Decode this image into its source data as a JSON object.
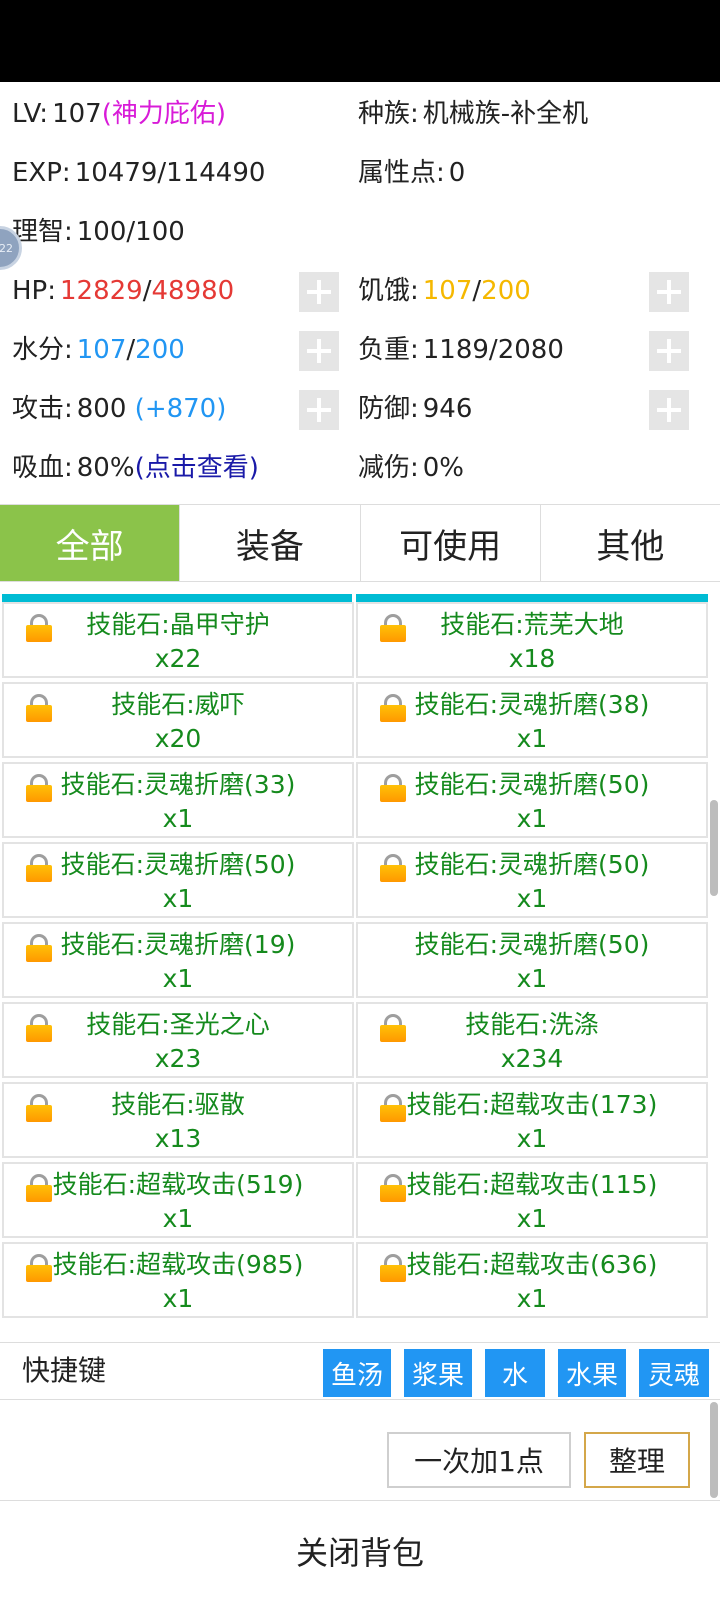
{
  "colors": {
    "red": "#e53935",
    "yellow": "#f5b800",
    "blue": "#2196f3",
    "magenta": "#d81bd8",
    "navy": "#1a1aa8",
    "green": "#158a1d",
    "tab_active": "#8bc34a"
  },
  "stats": {
    "lv_label": "LV:",
    "lv_value": "107",
    "lv_title": "(神力庇佑)",
    "race_label": "种族:",
    "race_value": "机械族-补全机",
    "exp_label": "EXP:",
    "exp_value": "10479/114490",
    "attr_label": "属性点:",
    "attr_value": "0",
    "sanity_label": "理智:",
    "sanity_value": "100/100",
    "hp_label": "HP:",
    "hp_cur": "12829",
    "hp_sep": "/",
    "hp_max": "48980",
    "hunger_label": "饥饿:",
    "hunger_cur": "107",
    "hunger_sep": "/",
    "hunger_max": "200",
    "water_label": "水分:",
    "water_cur": "107",
    "water_sep": "/",
    "water_max": "200",
    "load_label": "负重:",
    "load_value": "1189/2080",
    "atk_label": "攻击:",
    "atk_value": "800",
    "atk_bonus": "(+870)",
    "def_label": "防御:",
    "def_value": "946",
    "leech_label": "吸血:",
    "leech_value": "80%",
    "leech_link": "(点击查看)",
    "reduce_label": "减伤:",
    "reduce_value": "0%"
  },
  "float_ball_text": "22",
  "tabs": [
    "全部",
    "装备",
    "可使用",
    "其他"
  ],
  "items": [
    {
      "name": "技能石:晶甲守护",
      "count": "x22",
      "locked": true
    },
    {
      "name": "技能石:荒芜大地",
      "count": "x18",
      "locked": true
    },
    {
      "name": "技能石:威吓",
      "count": "x20",
      "locked": true
    },
    {
      "name": "技能石:灵魂折磨(38)",
      "count": "x1",
      "locked": true
    },
    {
      "name": "技能石:灵魂折磨(33)",
      "count": "x1",
      "locked": true
    },
    {
      "name": "技能石:灵魂折磨(50)",
      "count": "x1",
      "locked": true
    },
    {
      "name": "技能石:灵魂折磨(50)",
      "count": "x1",
      "locked": true
    },
    {
      "name": "技能石:灵魂折磨(50)",
      "count": "x1",
      "locked": true
    },
    {
      "name": "技能石:灵魂折磨(19)",
      "count": "x1",
      "locked": true
    },
    {
      "name": "技能石:灵魂折磨(50)",
      "count": "x1",
      "locked": false
    },
    {
      "name": "技能石:圣光之心",
      "count": "x23",
      "locked": true
    },
    {
      "name": "技能石:洗涤",
      "count": "x234",
      "locked": true
    },
    {
      "name": "技能石:驱散",
      "count": "x13",
      "locked": true
    },
    {
      "name": "技能石:超载攻击(173)",
      "count": "x1",
      "locked": true
    },
    {
      "name": "技能石:超载攻击(519)",
      "count": "x1",
      "locked": true
    },
    {
      "name": "技能石:超载攻击(115)",
      "count": "x1",
      "locked": true
    },
    {
      "name": "技能石:超载攻击(985)",
      "count": "x1",
      "locked": true
    },
    {
      "name": "技能石:超载攻击(636)",
      "count": "x1",
      "locked": true
    }
  ],
  "hotkeys": {
    "label": "快捷键",
    "items": [
      "鱼汤",
      "浆果",
      "水",
      "水果",
      "灵魂"
    ]
  },
  "buttons": {
    "add_one": "一次加1点",
    "sort": "整理"
  },
  "footer": {
    "close": "关闭背包"
  }
}
